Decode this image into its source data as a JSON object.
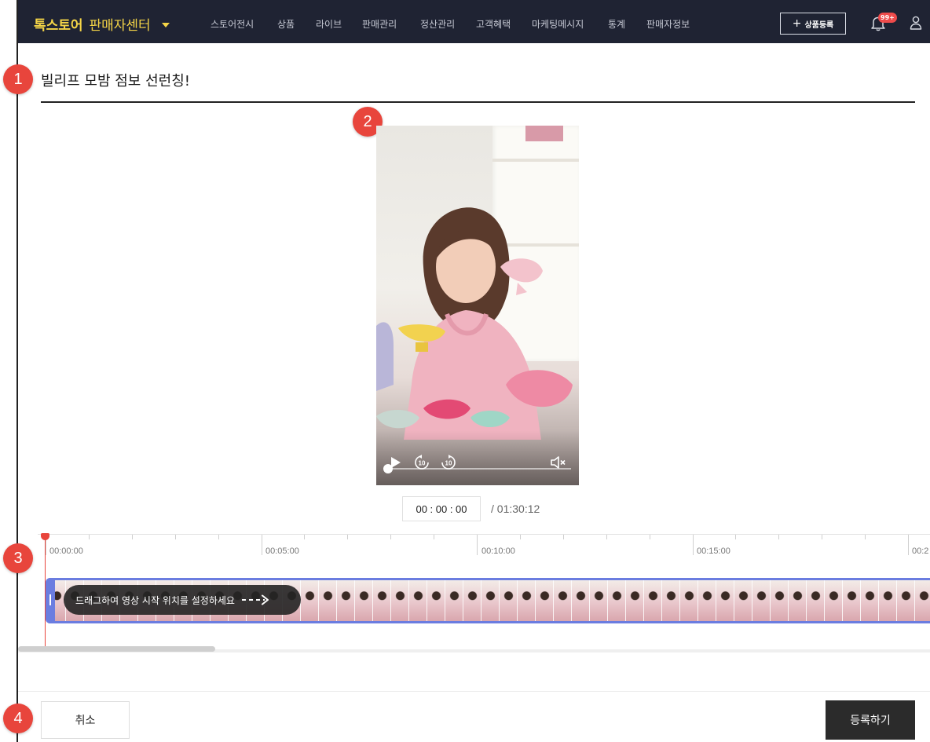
{
  "header": {
    "brand": "톡스토어",
    "brand_sub": "판매자센터",
    "nav": [
      "스토어전시",
      "상품",
      "라이브",
      "판매관리",
      "정산관리",
      "고객혜택",
      "마케팅메시지",
      "통계",
      "판매자정보"
    ],
    "register_button": "상품등록",
    "notification_badge": "99+",
    "accent_color": "#f5d547",
    "bar_color": "#1f2333"
  },
  "markers": [
    "1",
    "2",
    "3",
    "4"
  ],
  "page": {
    "title": "빌리프 모밤 점보 선런칭!"
  },
  "player": {
    "current_time": "00 : 00 : 00",
    "total_time": "/ 01:30:12",
    "progress": 0,
    "icons": [
      "play-icon",
      "rewind-10-icon",
      "forward-10-icon",
      "mute-icon"
    ]
  },
  "timeline": {
    "tick_labels": [
      "00:00:00",
      "00:05:00",
      "00:10:00",
      "00:15:00",
      "00:2"
    ],
    "drag_hint": "드래그하여 영상 시작 위치를 설정하세요",
    "selection_color": "#6b7de0",
    "playhead_color": "#e8453c"
  },
  "actions": {
    "cancel": "취소",
    "submit": "등록하기"
  }
}
